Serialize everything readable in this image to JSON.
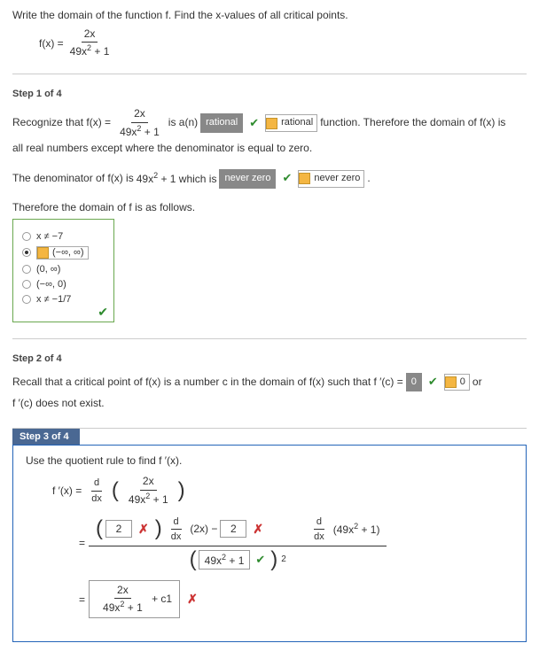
{
  "problem": {
    "instruction": "Write the domain of the function f. Find the x-values of all critical points.",
    "fx_label": "f(x) =",
    "num": "2x",
    "den_pre": "49x",
    "den_exp": "2",
    "den_post": " + 1"
  },
  "step1": {
    "label": "Step 1 of 4",
    "recognize_pre": "Recognize that  f(x) =",
    "isa": " is a(n) ",
    "box_rational": "rational",
    "tag_rational": "rational",
    "func_therefore": " function. Therefore the domain of  f(x)  is",
    "line2": "all real numbers except where the denominator is equal to zero.",
    "denom_pre": "The denominator of  f(x)  is  ",
    "denom_expr_pre": "49x",
    "denom_expr_exp": "2",
    "denom_expr_post": " + 1  which is ",
    "box_never": "never zero",
    "tag_never": "never zero",
    "period": " .",
    "therefore_domain": "Therefore the domain of f is as follows.",
    "options": {
      "o1": "x ≠ −7",
      "o2": "(−∞, ∞)",
      "o3": "(0, ∞)",
      "o4": "(−∞, 0)",
      "o5": "x ≠ −1/7"
    }
  },
  "step2": {
    "label": "Step 2 of 4",
    "recall_pre": "Recall that a critical point of  f(x)  is a number c in the domain of  f(x)  such that  f ′(c) = ",
    "box_zero": "0",
    "tag_zero": "0",
    "or_text": "  or",
    "line2": "f ′(c)  does not exist."
  },
  "step3": {
    "label": "Step 3 of 4",
    "use_rule": "Use the quotient rule to find  f ′(x).",
    "fprime_eq": "f ′(x)  =",
    "ddx": "d",
    "dx_den": "dx",
    "inner_num": "2x",
    "inner_den_a": "49x",
    "inner_den_exp": "2",
    "inner_den_b": " + 1",
    "row2_box1": "2",
    "row2_mid_a": "(2x) − ",
    "row2_box2": "2",
    "row2_right_a": "(49x",
    "row2_right_exp": "2",
    "row2_right_b": " + 1)",
    "row2_den_box": "49x",
    "row2_den_exp": "2",
    "row2_den_post": " + 1",
    "row2_den_outer_exp": "2",
    "row3_eq": "=",
    "row3_num": "2x",
    "row3_den_a": "49x",
    "row3_den_exp": "2",
    "row3_den_b": " + 1",
    "row3_plus": " + c1"
  }
}
